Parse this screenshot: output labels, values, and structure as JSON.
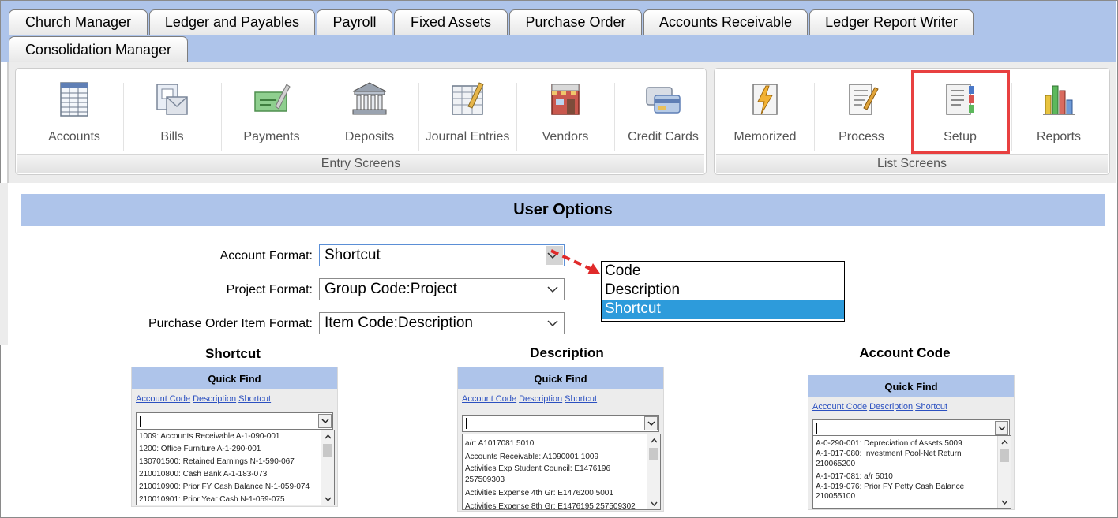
{
  "tabs": [
    {
      "label": "Church Manager"
    },
    {
      "label": "Ledger and Payables"
    },
    {
      "label": "Payroll"
    },
    {
      "label": "Fixed Assets"
    },
    {
      "label": "Purchase Order"
    },
    {
      "label": "Accounts Receivable"
    },
    {
      "label": "Ledger Report Writer"
    },
    {
      "label": "Consolidation Manager"
    }
  ],
  "ribbon": {
    "entry_group_label": "Entry Screens",
    "list_group_label": "List Screens",
    "entry_buttons": [
      {
        "label": "Accounts",
        "icon": "accounts-icon"
      },
      {
        "label": "Bills",
        "icon": "bills-icon"
      },
      {
        "label": "Payments",
        "icon": "payments-icon"
      },
      {
        "label": "Deposits",
        "icon": "deposits-icon"
      },
      {
        "label": "Journal Entries",
        "icon": "journal-entries-icon"
      },
      {
        "label": "Vendors",
        "icon": "vendors-icon"
      },
      {
        "label": "Credit Cards",
        "icon": "credit-cards-icon"
      }
    ],
    "list_buttons": [
      {
        "label": "Memorized",
        "icon": "memorized-icon"
      },
      {
        "label": "Process",
        "icon": "process-icon"
      },
      {
        "label": "Setup",
        "icon": "setup-icon"
      },
      {
        "label": "Reports",
        "icon": "reports-icon"
      }
    ],
    "highlight_color": "#e84040"
  },
  "user_options": {
    "title": "User Options",
    "fields": [
      {
        "label": "Account Format:",
        "value": "Shortcut"
      },
      {
        "label": "Project Format:",
        "value": "Group Code:Project"
      },
      {
        "label": "Purchase Order Item Format:",
        "value": "Item Code:Description"
      }
    ],
    "dropdown_options": [
      "Code",
      "Description",
      "Shortcut"
    ],
    "dropdown_selected": "Shortcut"
  },
  "examples": [
    {
      "title": "Shortcut",
      "panel_title": "Quick Find",
      "links": [
        "Account Code",
        "Description",
        "Shortcut"
      ],
      "rows": [
        "1009: Accounts Receivable A-1-090-001",
        "1200: Office Furniture A-1-290-001",
        "130701500: Retained Earnings N-1-590-067",
        "210010800: Cash Bank A-1-183-073",
        "210010900: Prior FY Cash Balance N-1-059-074",
        "210010901: Prior Year Cash N-1-059-075"
      ]
    },
    {
      "title": "Description",
      "panel_title": "Quick Find",
      "links": [
        "Account Code",
        "Description",
        "Shortcut"
      ],
      "rows": [
        "a/r: A1017081 5010",
        "Accounts Receivable: A1090001 1009",
        "Activities Exp Student Council: E1476196",
        "257509303",
        "Activities Expense 4th Gr: E1476200 5001",
        "Activities Expense 8th Gr: E1476195 257509302"
      ]
    },
    {
      "title": "Account Code",
      "panel_title": "Quick Find",
      "links": [
        "Account Code",
        "Description",
        "Shortcut"
      ],
      "rows": [
        "A-0-290-001: Depreciation of Assets 5009",
        "A-1-017-080: Investment Pool-Net Return",
        "210065200",
        "A-1-017-081: a/r 5010",
        "A-1-019-076: Prior FY Petty Cash Balance",
        "210055100"
      ]
    }
  ],
  "colors": {
    "header_blue": "#aec4ea",
    "selected_blue": "#2d9bdb",
    "link_blue": "#2b50c0"
  }
}
